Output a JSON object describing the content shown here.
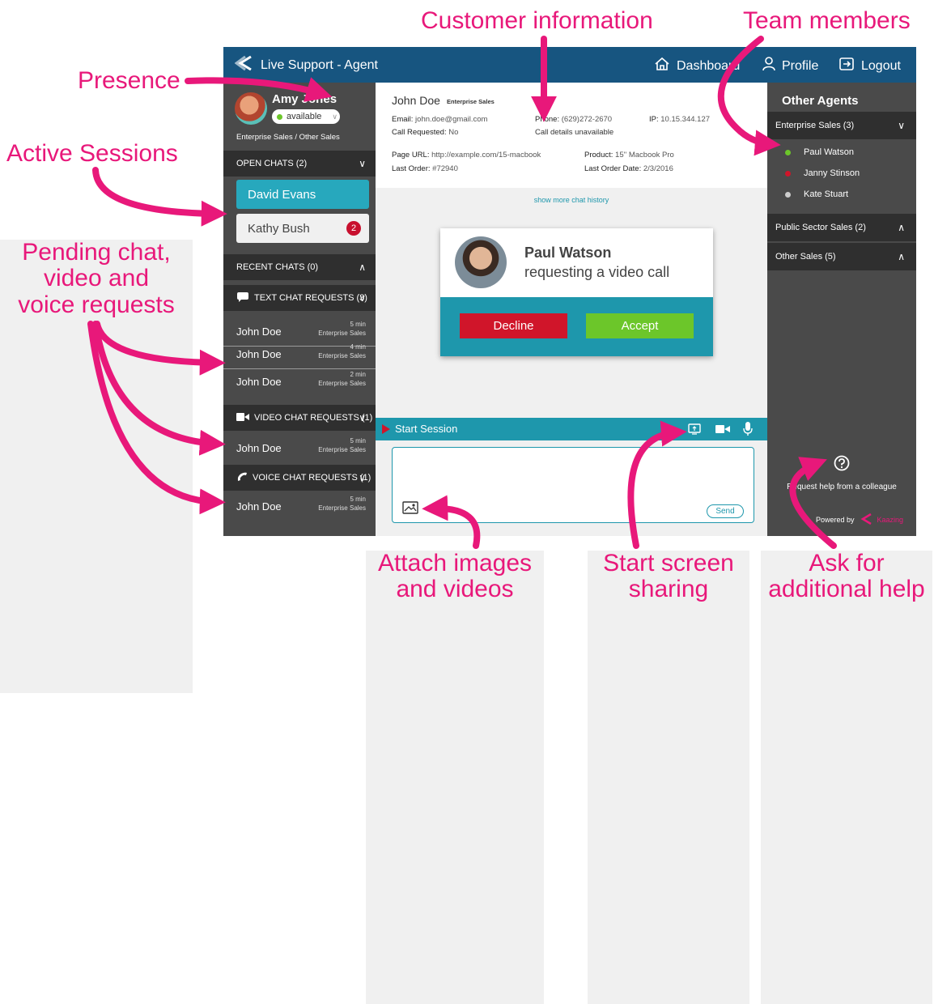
{
  "annotations": {
    "customer_information": "Customer information",
    "team_members": "Team members",
    "presence": "Presence",
    "active_sessions": "Active Sessions",
    "pending_line1": "Pending chat,",
    "pending_line2": "video and",
    "pending_line3": "voice requests",
    "attach_line1": "Attach images",
    "attach_line2": "and videos",
    "screen_line1": "Start screen",
    "screen_line2": "sharing",
    "help_line1": "Ask for",
    "help_line2": "additional help",
    "color": "#e8187a"
  },
  "topbar": {
    "title": "Live Support - Agent",
    "dashboard": "Dashboard",
    "profile": "Profile",
    "logout": "Logout",
    "bg": "#175580"
  },
  "agent": {
    "name": "Amy Jones",
    "status": "available",
    "team": "Enterprise Sales / Other Sales"
  },
  "open_chats": {
    "header": "OPEN CHATS (2)",
    "items": [
      {
        "name": "David Evans"
      },
      {
        "name": "Kathy Bush",
        "badge": "2"
      }
    ]
  },
  "recent_chats": {
    "header": "RECENT CHATS (0)"
  },
  "text_requests": {
    "header": "TEXT CHAT REQUESTS (3)",
    "items": [
      {
        "name": "John Doe",
        "time": "5 min",
        "team": "Enterprise Sales"
      },
      {
        "name": "John Doe",
        "time": "4 min",
        "team": "Enterprise Sales"
      },
      {
        "name": "John Doe",
        "time": "2 min",
        "team": "Enterprise Sales"
      }
    ]
  },
  "video_requests": {
    "header": "VIDEO CHAT REQUESTS (1)",
    "items": [
      {
        "name": "John Doe",
        "time": "5 min",
        "team": "Enterprise Sales"
      }
    ]
  },
  "voice_requests": {
    "header": "VOICE CHAT REQUESTS (1)",
    "items": [
      {
        "name": "John Doe",
        "time": "5 min",
        "team": "Enterprise Sales"
      }
    ]
  },
  "customer": {
    "name": "John Doe",
    "tag": "Enterprise Sales",
    "email_label": "Email:",
    "email": "john.doe@gmail.com",
    "phone_label": "Phone:",
    "phone": "(629)272-2670",
    "ip_label": "IP:",
    "ip": "10.15.344.127",
    "call_req_label": "Call Requested:",
    "call_req": "No",
    "call_details": "Call details unavailable",
    "page_url_label": "Page URL:",
    "page_url": "http://example.com/15-macbook",
    "product_label": "Product:",
    "product": "15'' Macbook Pro",
    "last_order_label": "Last Order:",
    "last_order": "#72940",
    "last_order_date_label": "Last Order Date:",
    "last_order_date": "2/3/2016"
  },
  "history_link": "show more chat history",
  "incoming_call": {
    "caller": "Paul Watson",
    "message": "requesting a video call",
    "decline": "Decline",
    "accept": "Accept"
  },
  "session": {
    "start_label": "Start Session",
    "send": "Send"
  },
  "other_agents": {
    "title": "Other Agents",
    "groups": [
      {
        "label": "Enterprise Sales (3)",
        "expanded": true,
        "members": [
          {
            "name": "Paul Watson",
            "status_color": "#6cc62a"
          },
          {
            "name": "Janny Stinson",
            "status_color": "#d0152a"
          },
          {
            "name": "Kate Stuart",
            "status_color": "#cccccc"
          }
        ]
      },
      {
        "label": "Public Sector Sales (2)",
        "expanded": false
      },
      {
        "label": "Other Sales (5)",
        "expanded": false
      }
    ],
    "help_text": "Request help from a colleague",
    "powered_by": "Powered by",
    "powered_brand": "Kaazing"
  }
}
